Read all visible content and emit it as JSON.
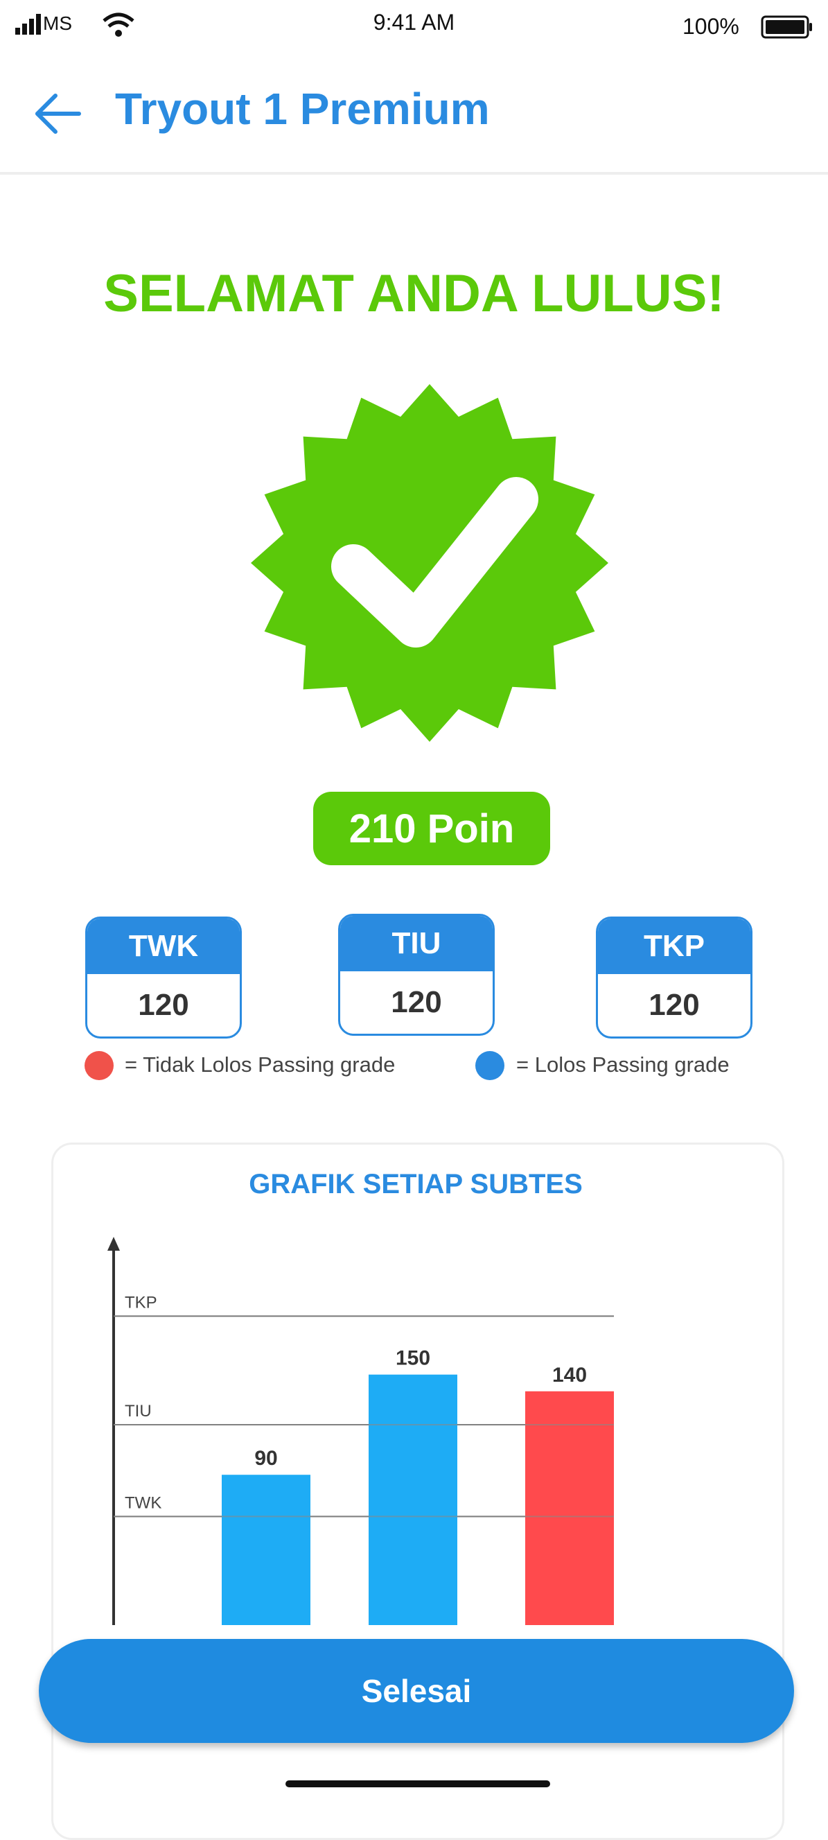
{
  "status_bar": {
    "carrier": "MS",
    "time": "9:41 AM",
    "battery": "100%"
  },
  "header": {
    "title": "Tryout 1 Premium"
  },
  "result": {
    "message": "SELAMAT ANDA LULUS!",
    "points": "210 Poin"
  },
  "scores": [
    {
      "label": "TWK",
      "value": "120"
    },
    {
      "label": "TIU",
      "value": "120"
    },
    {
      "label": "TKP",
      "value": "120"
    }
  ],
  "legend": {
    "fail": {
      "text": "= Tidak Lolos Passing grade",
      "color": "#f0524a"
    },
    "pass": {
      "text": "=  Lolos Passing grade",
      "color": "#2a8be0"
    }
  },
  "chart_title": "GRAFIK SETIAP SUBTES",
  "chart_data": {
    "type": "bar",
    "title": "GRAFIK SETIAP SUBTES",
    "values": [
      90,
      150,
      140
    ],
    "data_labels": [
      "90",
      "150",
      "140"
    ],
    "colors": [
      "#1eacf5",
      "#1eacf5",
      "#ff4a4d"
    ],
    "reference_lines": [
      {
        "label": "TWK",
        "value": 65
      },
      {
        "label": "TIU",
        "value": 120
      },
      {
        "label": "TKP",
        "value": 185
      }
    ],
    "ylim": [
      0,
      230
    ],
    "grid": false
  },
  "footer": {
    "button_label": "Selesai"
  },
  "colors": {
    "accent": "#2a8be0",
    "success": "#5bc90a",
    "fail": "#ff4a4d",
    "pass_bar": "#1eacf5"
  },
  "icons": {
    "back": "arrow-left-icon",
    "badge": "check-badge-icon"
  }
}
